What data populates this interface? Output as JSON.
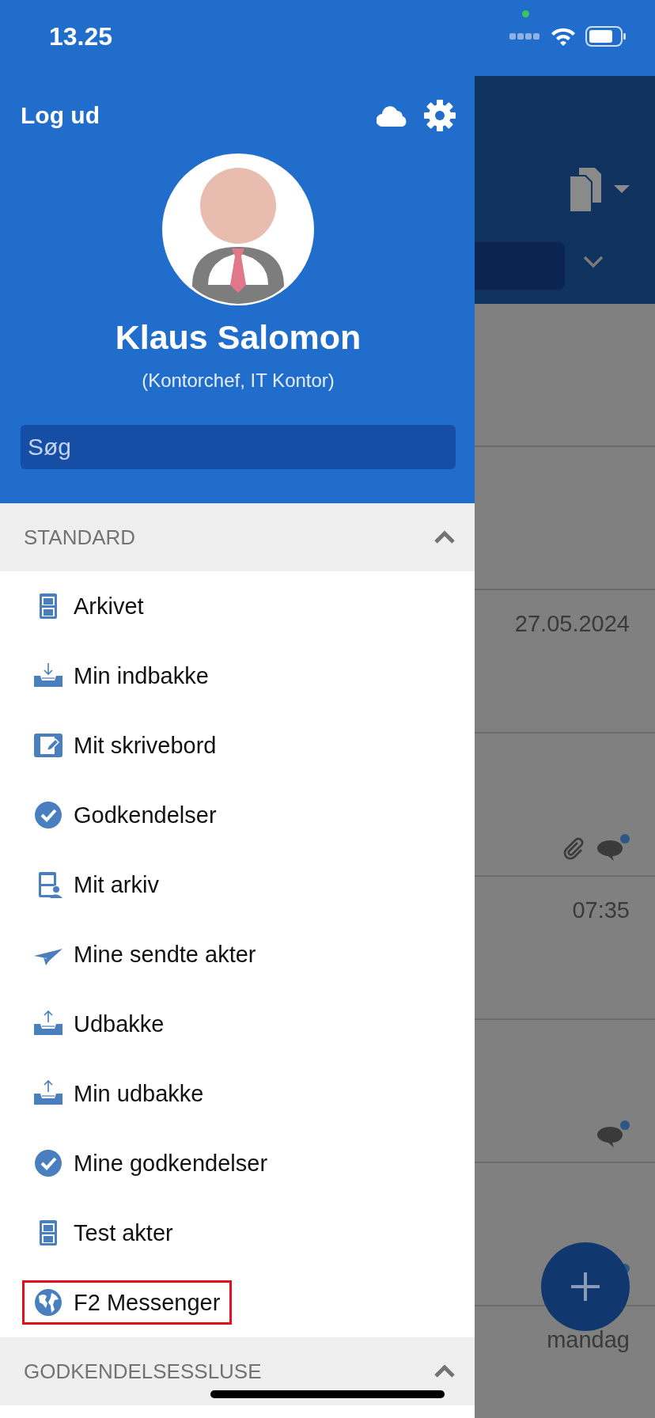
{
  "status_bar": {
    "time": "13.25"
  },
  "drawer": {
    "logout_label": "Log ud",
    "user": {
      "name": "Klaus Salomon",
      "role": "(Kontorchef, IT Kontor)"
    },
    "search": {
      "placeholder": "Søg"
    },
    "sections": [
      {
        "title": "STANDARD",
        "expanded": true,
        "items": [
          {
            "label": "Arkivet",
            "kind": "cabinet",
            "highlighted": false
          },
          {
            "label": "Min indbakke",
            "kind": "inbox",
            "highlighted": false
          },
          {
            "label": "Mit skrivebord",
            "kind": "desk",
            "highlighted": false
          },
          {
            "label": "Godkendelser",
            "kind": "check",
            "highlighted": false
          },
          {
            "label": "Mit arkiv",
            "kind": "cabinet-user",
            "highlighted": false
          },
          {
            "label": "Mine sendte akter",
            "kind": "plane",
            "highlighted": false
          },
          {
            "label": "Udbakke",
            "kind": "outbox",
            "highlighted": false
          },
          {
            "label": "Min udbakke",
            "kind": "outbox",
            "highlighted": false
          },
          {
            "label": "Mine godkendelser",
            "kind": "check",
            "highlighted": false
          },
          {
            "label": "Test akter",
            "kind": "cabinet",
            "highlighted": false
          },
          {
            "label": "F2 Messenger",
            "kind": "globe",
            "highlighted": true
          }
        ]
      },
      {
        "title": "GODKENDELSESSLUSE",
        "expanded": true
      }
    ]
  },
  "background_list": {
    "rows": [
      {},
      {},
      {
        "time": "27.05.2024"
      },
      {
        "icons": [
          {
            "kind": "paperclip"
          },
          {
            "kind": "comment-unread"
          }
        ]
      },
      {
        "time": "07:35"
      },
      {
        "icons": [
          {
            "kind": "comment-unread"
          }
        ]
      },
      {
        "icons": [
          {
            "kind": "unread-dot"
          }
        ]
      },
      {
        "time": "mandag"
      }
    ]
  }
}
